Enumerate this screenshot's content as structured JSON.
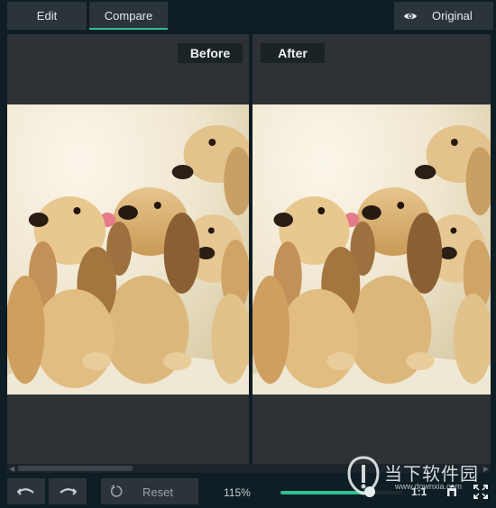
{
  "toolbar": {
    "tabs": [
      {
        "label": "Edit",
        "active": false
      },
      {
        "label": "Compare",
        "active": true
      }
    ],
    "original_label": "Original",
    "original_icon": "eye-icon"
  },
  "compare": {
    "before_label": "Before",
    "after_label": "After",
    "photo_subject": "puppies"
  },
  "bottom": {
    "reset_label": "Reset",
    "zoom_text": "115%",
    "zoom_slider_fraction": 0.73,
    "ratio_label": "1:1",
    "icons": [
      "undo-icon",
      "redo-icon",
      "reset-icon",
      "fit-icon",
      "fullscreen-icon"
    ]
  },
  "watermark": {
    "cn": "当下软件园",
    "url": "www.downxia.com"
  },
  "colors": {
    "accent": "#2fbf8f",
    "panel": "#2c3236",
    "background": "#0f1d24",
    "button": "#2b3439"
  }
}
